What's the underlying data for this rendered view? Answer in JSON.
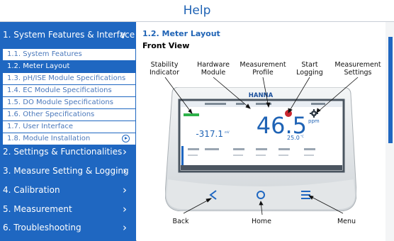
{
  "window": {
    "title": "Help"
  },
  "sidebar": {
    "sections": [
      {
        "label": "1. System Features & Interface",
        "chevron": "down"
      },
      {
        "label": "2. Settings & Functionalities",
        "chevron": "right"
      },
      {
        "label": "3. Measure Setting & Logging",
        "chevron": "right"
      },
      {
        "label": "4. Calibration",
        "chevron": "right"
      },
      {
        "label": "5. Measurement",
        "chevron": "right"
      },
      {
        "label": "6. Troubleshooting",
        "chevron": "right"
      }
    ],
    "subitems": [
      {
        "label": "1.1. System Features"
      },
      {
        "label": "1.2. Meter Layout",
        "active": true
      },
      {
        "label": "1.3. pH/ISE Module Specifications"
      },
      {
        "label": "1.4. EC Module Specifications"
      },
      {
        "label": "1.5. DO Module Specifications"
      },
      {
        "label": "1.6. Other Specifications"
      },
      {
        "label": "1.7. User Interface"
      },
      {
        "label": "1.8. Module Installation"
      }
    ]
  },
  "main": {
    "heading": "1.2. Meter Layout",
    "subheading": "Front View",
    "callouts_top": {
      "stability": "Stability Indicator",
      "hardware": "Hardware Module",
      "profile": "Measurement Profile",
      "logging": "Start Logging",
      "settings": "Measurement Settings"
    },
    "callouts_bottom": {
      "back": "Back",
      "home": "Home",
      "menu": "Menu"
    },
    "device": {
      "brand": "HANNA",
      "main_reading": "46.5",
      "main_unit": "ppm",
      "secondary_reading": "-317.1",
      "secondary_unit": "mV",
      "temperature": "25.0",
      "temperature_unit": "°C"
    }
  },
  "colors": {
    "accent": "#1f67c1",
    "title_text": "#1f63b5"
  }
}
